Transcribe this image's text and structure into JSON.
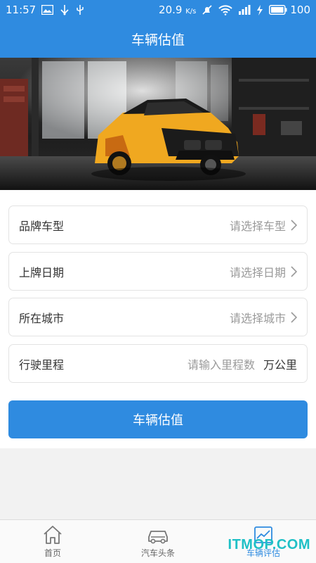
{
  "status_bar": {
    "time": "11:57",
    "speed": "20.9",
    "speed_unit": "K/s",
    "battery": "100",
    "icons": [
      "image-icon",
      "usb-icon",
      "usb-debug-icon",
      "mute-icon",
      "wifi-icon",
      "signal-icon",
      "charging-icon",
      "battery-icon"
    ]
  },
  "header": {
    "title": "车辆估值"
  },
  "hero": {
    "image": "sports-car-garage-photo"
  },
  "form": {
    "rows": [
      {
        "label": "品牌车型",
        "value": "请选择车型"
      },
      {
        "label": "上牌日期",
        "value": "请选择日期"
      },
      {
        "label": "所在城市",
        "value": "请选择城市"
      },
      {
        "label": "行驶里程",
        "placeholder": "请输入里程数",
        "unit": "万公里"
      }
    ],
    "submit_label": "车辆估值"
  },
  "tabs": [
    {
      "label": "首页",
      "icon": "home-icon",
      "active": false
    },
    {
      "label": "汽车头条",
      "icon": "car-icon",
      "active": false
    },
    {
      "label": "车辆评估",
      "icon": "chart-icon",
      "active": true
    }
  ],
  "watermark": "ITMOP.COM",
  "colors": {
    "primary": "#2f8be0",
    "watermark": "#1fc0c6"
  }
}
